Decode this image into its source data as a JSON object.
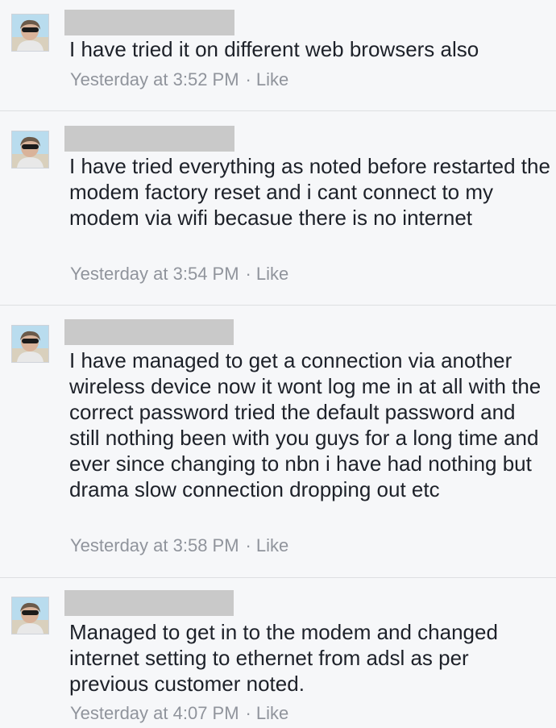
{
  "comments": [
    {
      "text": "I have tried it on different web browsers also",
      "time": "Yesterday at 3:52 PM",
      "like": "Like"
    },
    {
      "text": "I have tried everything as noted before restarted the modem factory reset and i cant connect to my modem via wifi becasue there is no internet",
      "time": "Yesterday at 3:54 PM",
      "like": "Like"
    },
    {
      "text": "I have managed to get a connection via another wireless device now it wont log me in at all with the correct password tried the default password and still nothing been with you guys for a long time and ever since changing to nbn i have had nothing but drama slow connection dropping out etc",
      "time": "Yesterday at 3:58 PM",
      "like": "Like"
    },
    {
      "text": "Managed to get in to the modem and changed internet setting to ethernet from adsl as per previous customer noted.",
      "time": "Yesterday at 4:07 PM",
      "like": "Like"
    }
  ],
  "separator": "·",
  "colors": {
    "background": "#f6f7f9",
    "text": "#1d2129",
    "meta": "#90949c",
    "redaction": "#c9c9c9",
    "divider": "#dddfe2"
  }
}
